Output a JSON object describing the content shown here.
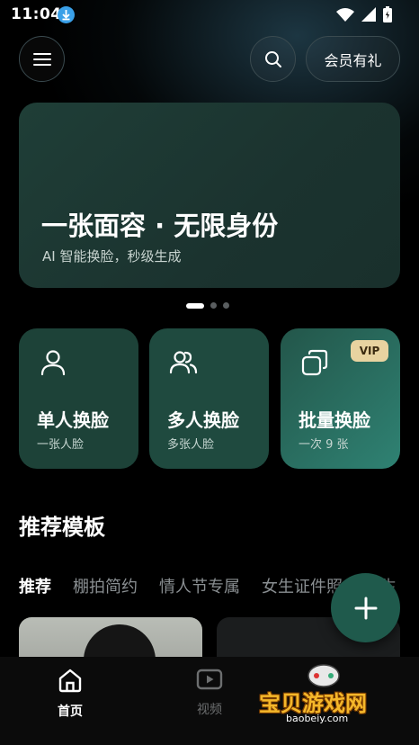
{
  "status_bar": {
    "time": "11:04"
  },
  "header": {
    "vip_gift_label": "会员有礼"
  },
  "banner": {
    "title": "一张面容 · 无限身份",
    "subtitle": "AI 智能换脸，秒级生成"
  },
  "features": [
    {
      "title": "单人换脸",
      "subtitle": "一张人脸",
      "icon": "person-icon"
    },
    {
      "title": "多人换脸",
      "subtitle": "多张人脸",
      "icon": "people-icon"
    },
    {
      "title": "批量换脸",
      "subtitle": "一次 9 张",
      "icon": "copy-icon",
      "badge": "VIP"
    }
  ],
  "templates": {
    "section_title": "推荐模板",
    "tabs": [
      "推荐",
      "棚拍简约",
      "情人节专属",
      "女生证件照",
      "男生"
    ]
  },
  "bottom_nav": {
    "home_label": "首页",
    "video_label": "视频"
  },
  "watermark": {
    "text": "宝贝游戏网",
    "url": "baobeiy.com"
  },
  "colors": {
    "accent": "#1f5a4c",
    "vip_badge": "#e8d3a0",
    "brand_watermark": "#f4b72a"
  }
}
